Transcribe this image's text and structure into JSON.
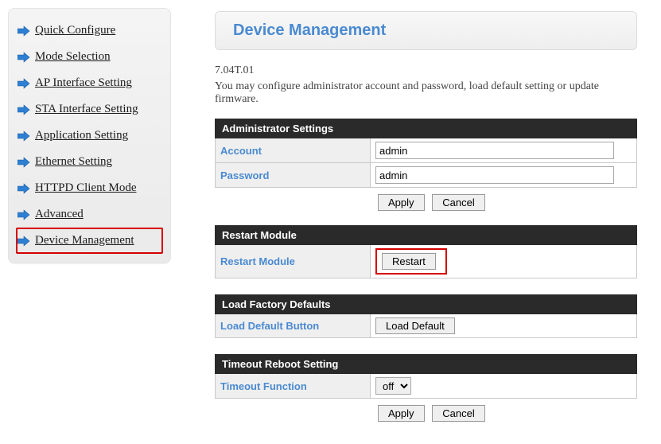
{
  "sidebar": {
    "items": [
      {
        "label": "Quick Configure",
        "active": false
      },
      {
        "label": "Mode Selection",
        "active": false
      },
      {
        "label": "AP Interface Setting",
        "active": false
      },
      {
        "label": "STA Interface Setting",
        "active": false
      },
      {
        "label": "Application Setting",
        "active": false
      },
      {
        "label": "Ethernet Setting",
        "active": false
      },
      {
        "label": "HTTPD Client Mode",
        "active": false
      },
      {
        "label": "Advanced",
        "active": false
      },
      {
        "label": "Device Management",
        "active": true
      }
    ]
  },
  "page": {
    "title": "Device Management",
    "version": "7.04T.01",
    "description": "You may configure administrator account and password, load default setting or update firmware."
  },
  "admin": {
    "section_title": "Administrator Settings",
    "account_label": "Account",
    "account_value": "admin",
    "password_label": "Password",
    "password_value": "admin",
    "apply_label": "Apply",
    "cancel_label": "Cancel"
  },
  "restart": {
    "section_title": "Restart Module",
    "restart_label": "Restart Module",
    "restart_button": "Restart"
  },
  "factory": {
    "section_title": "Load Factory Defaults",
    "load_label": "Load Default Button",
    "load_button": "Load Default"
  },
  "timeout": {
    "section_title": "Timeout Reboot Setting",
    "function_label": "Timeout Function",
    "function_value": "off",
    "apply_label": "Apply",
    "cancel_label": "Cancel"
  }
}
